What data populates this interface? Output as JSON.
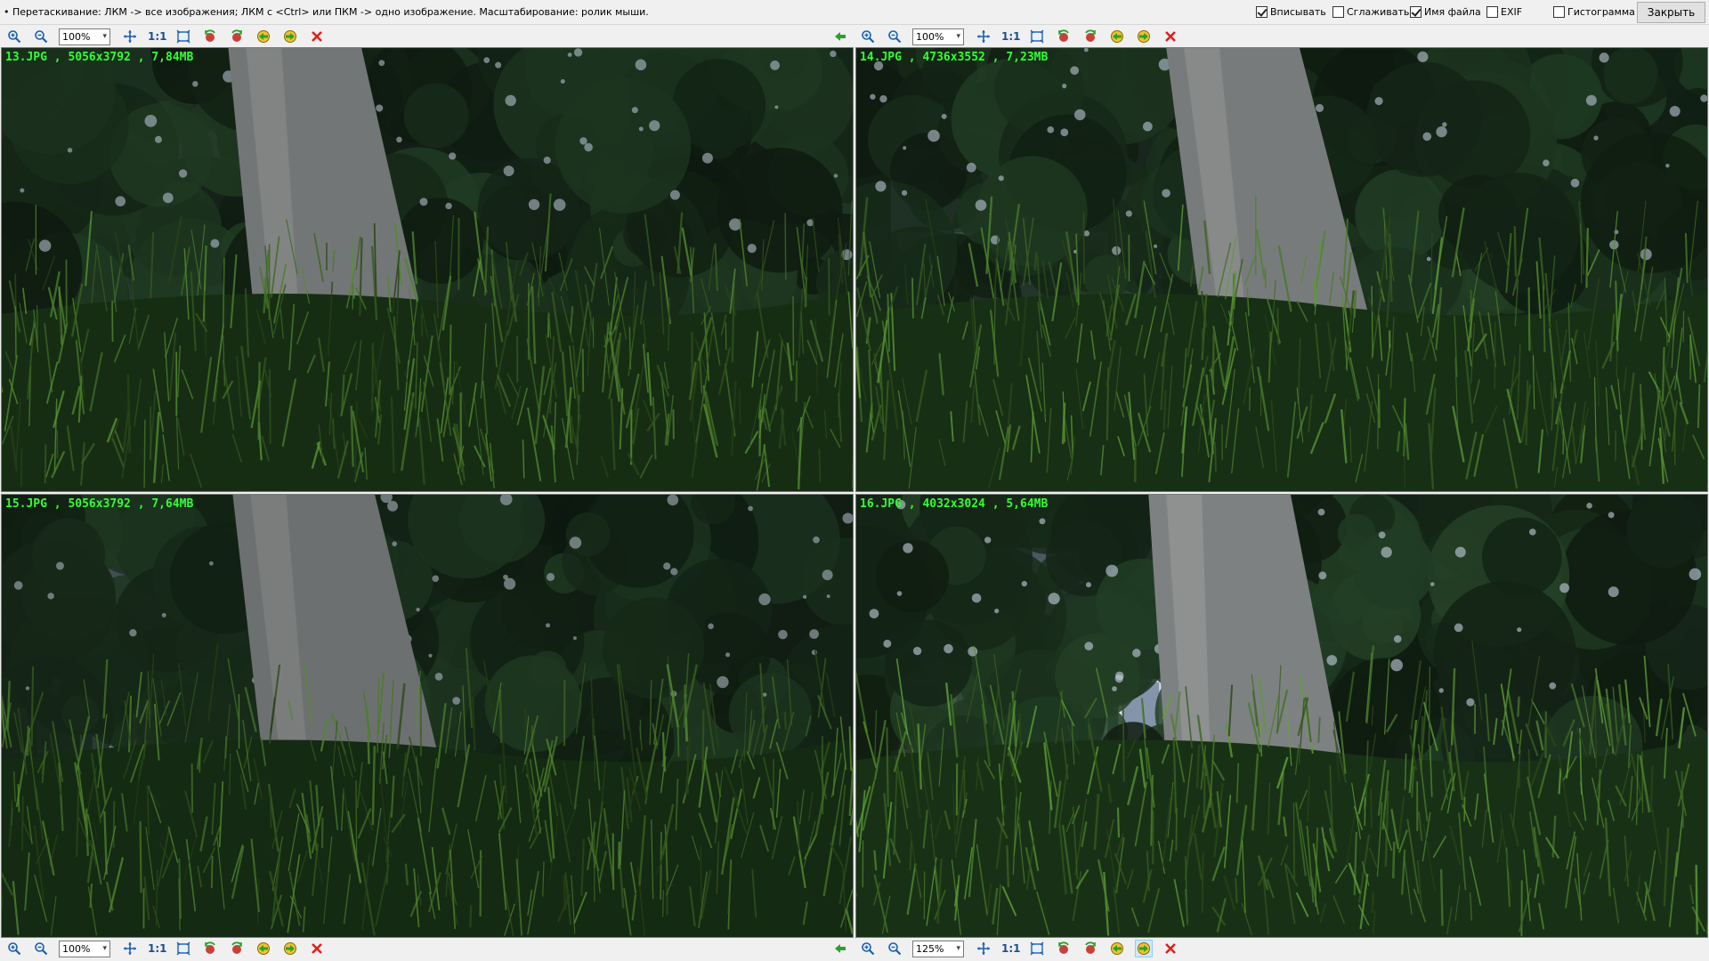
{
  "hint_text": "• Перетаскивание: ЛКМ -> все изображения; ЛКМ с <Ctrl> или ПКМ -> одно изображение. Масштабирование: ролик мыши.",
  "options": [
    {
      "label": "Вписывать",
      "checked": true
    },
    {
      "label": "Сглаживать",
      "checked": false
    },
    {
      "label": "Имя файла",
      "checked": true
    },
    {
      "label": "EXIF",
      "checked": false
    },
    {
      "label": "Гистограмма",
      "checked": false
    }
  ],
  "close_label": "Закрыть",
  "one_to_one_label": "1:1",
  "toolbars": {
    "top_left": {
      "zoom": "100%"
    },
    "top_right": {
      "zoom": "100%"
    },
    "bottom_left": {
      "zoom": "100%"
    },
    "bottom_right": {
      "zoom": "125%"
    }
  },
  "panes": [
    {
      "caption": "13.JPG , 5056x3792 , 7,84MB"
    },
    {
      "caption": "14.JPG , 4736x3552 , 7,23MB"
    },
    {
      "caption": "15.JPG , 5056x3792 , 7,64MB"
    },
    {
      "caption": "16.JPG , 4032x3024 , 5,64MB"
    }
  ],
  "icons": [
    "zoom-in-icon",
    "zoom-out-icon",
    "fit-icon",
    "one-to-one",
    "fit-window-icon",
    "rotate-left-icon",
    "rotate-right-icon",
    "prev-image-icon",
    "next-image-icon",
    "close-image-icon",
    "sync-arrow-icon"
  ],
  "colors": {
    "caption": "#33ff33",
    "close_x": "#e0201b",
    "link_arrow": "#2aa12a"
  }
}
